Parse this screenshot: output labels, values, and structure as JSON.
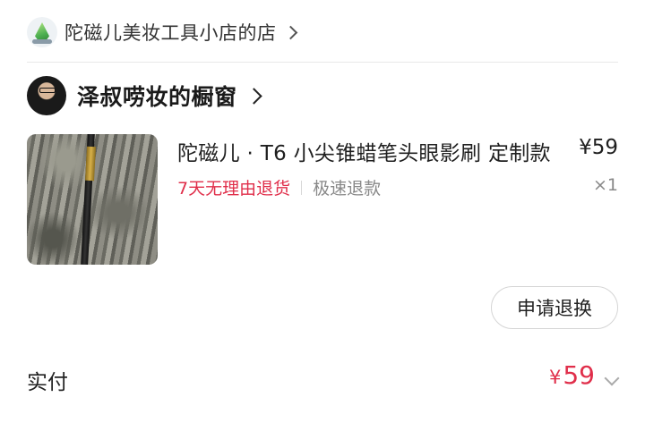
{
  "store": {
    "name": "陀磁儿美妆工具小店的店",
    "logo_icon": "store-logo-icon",
    "chevron_icon": "chevron-right-icon"
  },
  "showcase": {
    "name": "泽叔唠妆的橱窗",
    "avatar_icon": "avatar",
    "chevron_icon": "chevron-right-icon"
  },
  "product": {
    "title": "陀磁儿 · T6 小尖锥蜡笔头眼影刷 定制款",
    "price": "¥59",
    "return_tag": "7天无理由退货",
    "fast_refund_tag": "极速退款",
    "quantity": "×1",
    "thumbnail_icon": "product-image"
  },
  "actions": {
    "apply_return_label": "申请退换"
  },
  "payment": {
    "paid_label": "实付",
    "currency": "¥",
    "amount": "59",
    "expand_icon": "chevron-down-icon"
  },
  "colors": {
    "accent_red": "#e02e4a",
    "muted_text": "#888888"
  }
}
